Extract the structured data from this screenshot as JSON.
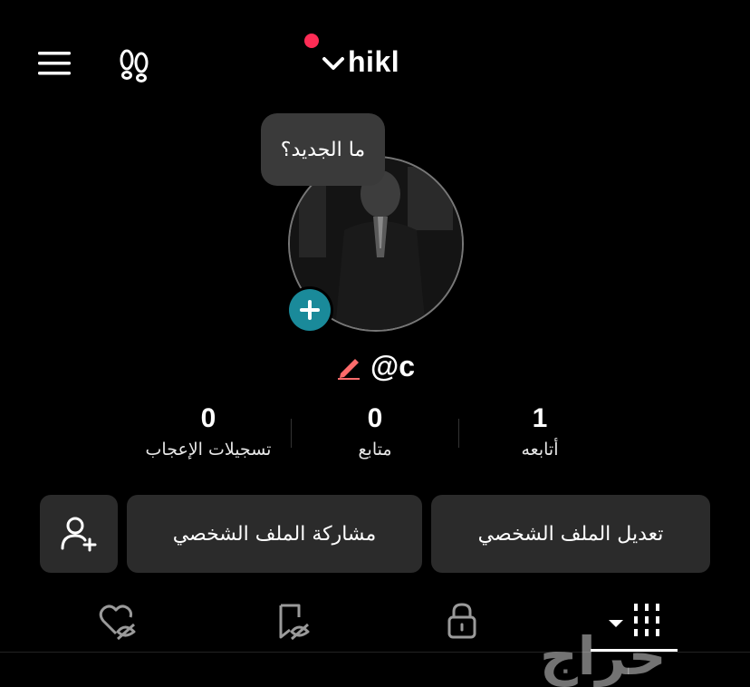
{
  "header": {
    "menu_icon": "hamburger-menu-icon",
    "footprints_icon": "footprints-icon",
    "username": "hikl",
    "dropdown_icon": "chevron-down-icon",
    "notification_dot_color": "#fe2c55"
  },
  "profile": {
    "bubble_text": "ما الجديد؟",
    "add_icon": "plus-icon",
    "add_color": "#1a8a9a",
    "handle": "@c",
    "edit_icon": "pencil-icon",
    "edit_color": "#fe6b6b"
  },
  "stats": [
    {
      "value": "1",
      "label": "أتابعه"
    },
    {
      "value": "0",
      "label": "متابع"
    },
    {
      "value": "0",
      "label": "تسجيلات الإعجاب"
    }
  ],
  "actions": {
    "edit_profile": "تعديل الملف الشخصي",
    "share_profile": "مشاركة الملف الشخصي",
    "add_friends_icon": "add-user-icon"
  },
  "tabs": [
    {
      "icon": "grid-icon",
      "selected": true
    },
    {
      "icon": "lock-icon"
    },
    {
      "icon": "bookmark-hidden-icon"
    },
    {
      "icon": "heart-hidden-icon"
    }
  ],
  "watermark": "حراج"
}
